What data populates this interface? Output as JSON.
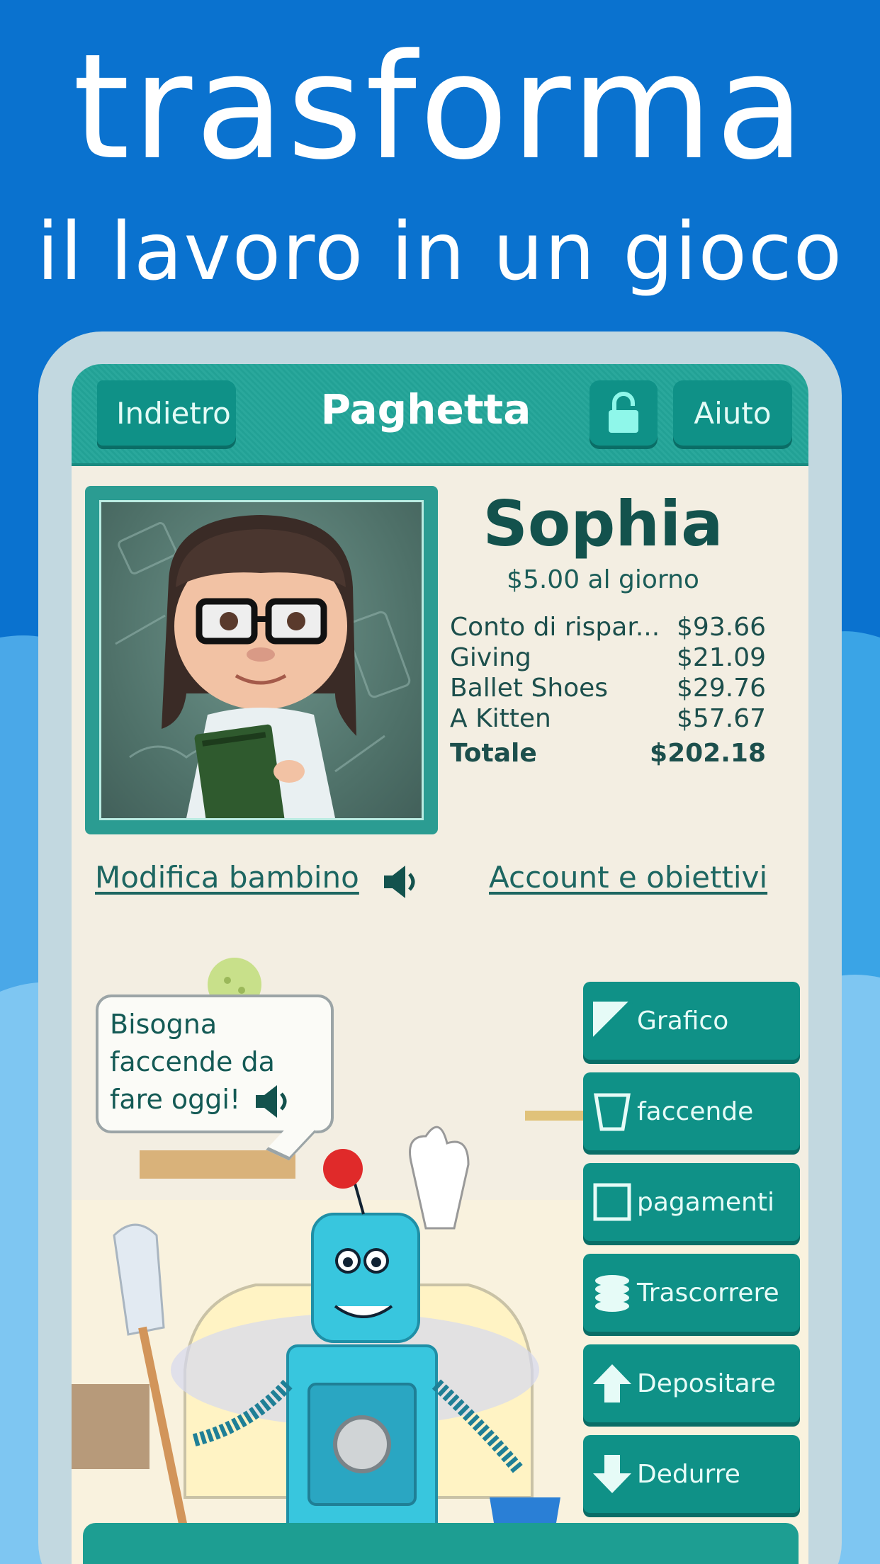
{
  "headline": {
    "line1": "trasforma",
    "line2": "il lavoro in un gioco"
  },
  "nav": {
    "back_label": "Indietro",
    "title": "Paghetta",
    "help_label": "Aiuto"
  },
  "profile": {
    "name": "Sophia",
    "rate": "$5.00 al giorno",
    "accounts": [
      {
        "name": "Conto di rispar...",
        "amount": "$93.66"
      },
      {
        "name": "Giving",
        "amount": "$21.09"
      },
      {
        "name": "Ballet Shoes",
        "amount": "$29.76"
      },
      {
        "name": "A Kitten",
        "amount": "$57.67"
      }
    ],
    "total_label": "Totale",
    "total_amount": "$202.18"
  },
  "links": {
    "edit_child": "Modifica bambino",
    "accounts_goals": "Account e obiettivi"
  },
  "bubble": {
    "line1": "Bisogna",
    "line2": "faccende da",
    "line3": "fare oggi!"
  },
  "actions": [
    {
      "label": "Grafico",
      "icon": "chart-icon"
    },
    {
      "label": "faccende",
      "icon": "bucket-icon"
    },
    {
      "label": "pagamenti",
      "icon": "checkbox-icon"
    },
    {
      "label": "Trascorrere",
      "icon": "coins-icon"
    },
    {
      "label": "Depositare",
      "icon": "arrow-up-icon"
    },
    {
      "label": "Dedurre",
      "icon": "arrow-down-icon"
    }
  ],
  "colors": {
    "background": "#0a72cf",
    "teal": "#0f9187",
    "paper": "#f3eee2",
    "text_dark": "#13524d"
  }
}
